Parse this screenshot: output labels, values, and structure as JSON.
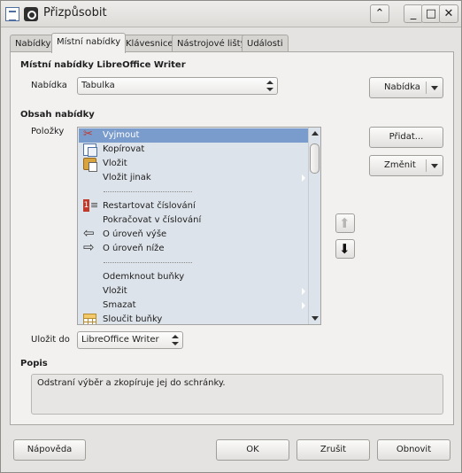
{
  "window": {
    "title": "Přizpůsobit",
    "buttons": {
      "minimize": "⌃",
      "minimize2": "_",
      "maximize": "□",
      "close": "✕"
    }
  },
  "tabs": [
    "Nabídky",
    "Místní nabídky",
    "Klávesnice",
    "Nástrojové lišty",
    "Události"
  ],
  "active_tab": "Místní nabídky",
  "menu_section": {
    "title": "Místní nabídky LibreOffice Writer",
    "menu_label": "Nabídka",
    "menu_value": "Tabulka",
    "menu_button": "Nabídka"
  },
  "content_section": {
    "title": "Obsah nabídky",
    "items_label": "Položky",
    "items": [
      {
        "label": "Vyjmout",
        "icon": "cut-icon",
        "selected": true
      },
      {
        "label": "Kopírovat",
        "icon": "copy-icon"
      },
      {
        "label": "Vložit",
        "icon": "paste-icon"
      },
      {
        "label": "Vložit jinak",
        "submenu": true
      },
      {
        "separator": true
      },
      {
        "label": "Restartovat číslování",
        "icon": "restart-numbering-icon"
      },
      {
        "label": "Pokračovat v číslování"
      },
      {
        "label": "O úroveň výše",
        "icon": "arrow-left-icon"
      },
      {
        "label": "O úroveň níže",
        "icon": "arrow-right-icon"
      },
      {
        "separator": true
      },
      {
        "label": "Odemknout buňky"
      },
      {
        "label": "Vložit",
        "submenu": true
      },
      {
        "label": "Smazat",
        "submenu": true
      },
      {
        "label": "Sloučit buňky",
        "icon": "merge-cells-icon"
      }
    ],
    "add_button": "Přidat...",
    "modify_button": "Změnit"
  },
  "save_in": {
    "label": "Uložit do",
    "value": "LibreOffice Writer"
  },
  "description": {
    "title": "Popis",
    "text": "Odstraní výběr a zkopíruje jej do schránky."
  },
  "footer": {
    "help": "Nápověda",
    "ok": "OK",
    "cancel": "Zrušit",
    "reset": "Obnovit"
  }
}
